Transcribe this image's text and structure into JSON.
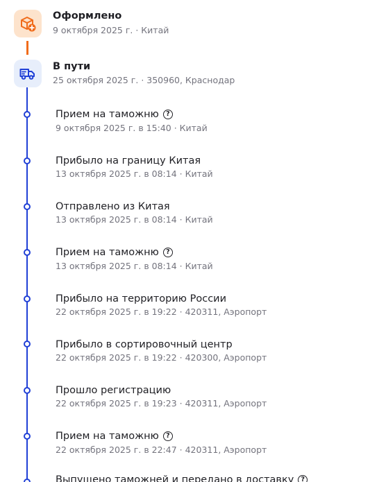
{
  "stages": [
    {
      "title": "Оформлено",
      "subtitle": "9 октября 2025 г. · Китай",
      "icon": "package-add-icon"
    },
    {
      "title": "В пути",
      "subtitle": "25 октября 2025 г. · 350960, Краснодар",
      "icon": "delivery-truck-icon"
    }
  ],
  "events": [
    {
      "title": "Прием на таможню",
      "subtitle": "9 октября 2025 г. в 15:40 · Китай",
      "help": "?"
    },
    {
      "title": "Прибыло на границу Китая",
      "subtitle": "13 октября 2025 г. в 08:14 · Китай"
    },
    {
      "title": "Отправлено из Китая",
      "subtitle": "13 октября 2025 г. в 08:14 · Китай"
    },
    {
      "title": "Прием на таможню",
      "subtitle": "13 октября 2025 г. в 08:14 · Китай",
      "help": "?"
    },
    {
      "title": "Прибыло на территорию России",
      "subtitle": "22 октября 2025 г. в 19:22 · 420311, Аэропорт"
    },
    {
      "title": "Прибыло в сортировочный центр",
      "subtitle": "22 октября 2025 г. в 19:22 · 420300, Аэропорт"
    },
    {
      "title": "Прошло регистрацию",
      "subtitle": "22 октября 2025 г. в 19:23 · 420311, Аэропорт"
    },
    {
      "title": "Прием на таможню",
      "subtitle": "22 октября 2025 г. в 22:47 · 420311, Аэропорт",
      "help": "?"
    },
    {
      "title": "Выпущено таможней и передано в доставку",
      "subtitle": "",
      "help": "?"
    }
  ],
  "colors": {
    "accent_orange": "#f06b1a",
    "accent_blue": "#1f3fd6",
    "muted_text": "#73737d"
  }
}
